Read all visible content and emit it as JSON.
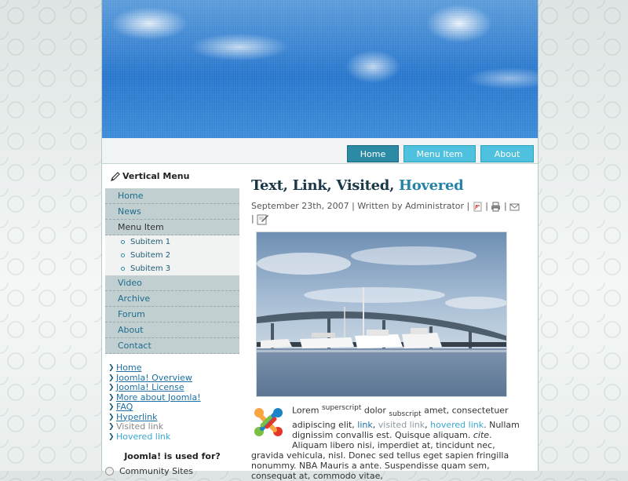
{
  "nav": {
    "tabs": [
      {
        "label": "Home"
      },
      {
        "label": "Menu Item"
      },
      {
        "label": "About"
      }
    ]
  },
  "sidebar": {
    "vertical_menu_title": "Vertical Menu",
    "menu_items": [
      "Home",
      "News",
      "Menu Item"
    ],
    "subitems": [
      "Subitem 1",
      "Subitem 2",
      "Subitem 3"
    ],
    "menu_items_after": [
      "Video",
      "Archive",
      "Forum",
      "About",
      "Contact"
    ],
    "links": [
      "Home",
      "Joomla! Overview",
      "Joomla! License",
      "More about Joomla!",
      "FAQ",
      "Hyperlink",
      "Visited link",
      "Hovered link"
    ],
    "poll_title": "Joomla! is used for?",
    "poll_option": "Community Sites"
  },
  "article": {
    "title_text": "Text,",
    "title_link": "Link,",
    "title_visited": "Visited,",
    "title_hovered": "Hovered",
    "meta": "September 23th, 2007 | Written by Administrator |",
    "body": {
      "lorem": "Lorem",
      "superscript": "superscript",
      "dolor": "dolor",
      "subscript": "subscript",
      "p1": "amet, consectetuer adipiscing elit,",
      "link": "link",
      "visited": "visited link",
      "hovered": "hovered link",
      "p2": ". Nullam dignissim convallis est. Quisque aliquam.",
      "cite": "cite",
      "p3": ". Aliquam libero nisi, imperdiet at, tincidunt nec, gravida vehicula, nisl. Donec sed tellus eget sapien fringilla nonummy. NBA Mauris a ante. Suspendisse quam sem, consequat at, commodo vitae,"
    }
  },
  "colors": {
    "tab": "#4fc0de",
    "tab_active": "#2b8aa4",
    "menu_bg": "#c2cfd1",
    "link": "#1d6fa3"
  },
  "icons": [
    "pencil-icon",
    "pdf-icon",
    "print-icon",
    "email-icon",
    "edit-icon",
    "joomla-logo-icon"
  ]
}
